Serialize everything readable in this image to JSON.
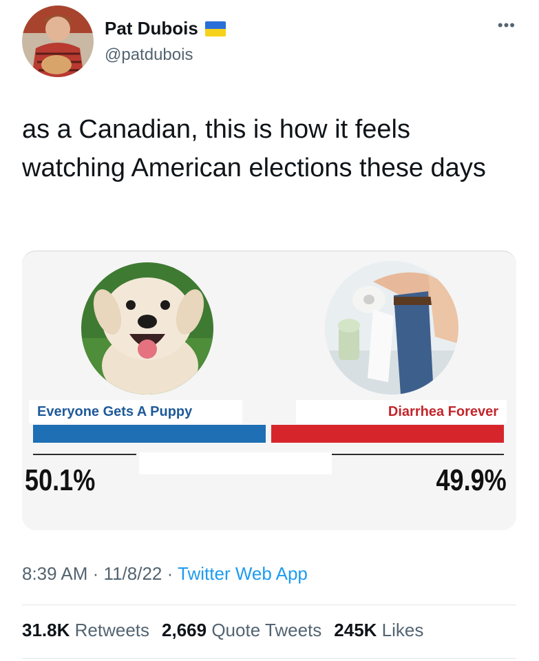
{
  "author": {
    "name": "Pat Dubois",
    "handle": "@patdubois",
    "flag_icon": "ukraine-flag-icon",
    "flag_colors": [
      "#2a6fd8",
      "#f6d21c"
    ]
  },
  "more_icon": "more-icon",
  "more_glyph": "•••",
  "tweet": {
    "text": "as a Canadian, this is how it feels watching American elections these days"
  },
  "poll_image": {
    "left": {
      "label": "Everyone Gets A Puppy",
      "percent": "50.1%",
      "color": "#1e6fb4",
      "photo": "puppy-photo"
    },
    "right": {
      "label": "Diarrhea Forever",
      "percent": "49.9%",
      "color": "#d6262c",
      "photo": "toilet-paper-photo"
    }
  },
  "meta": {
    "time": "8:39 AM",
    "sep1": "·",
    "date": "11/8/22",
    "sep2": "·",
    "source": "Twitter Web App"
  },
  "stats": {
    "retweets_count": "31.8K",
    "retweets_label": "Retweets",
    "quotes_count": "2,669",
    "quotes_label": "Quote Tweets",
    "likes_count": "245K",
    "likes_label": "Likes"
  }
}
